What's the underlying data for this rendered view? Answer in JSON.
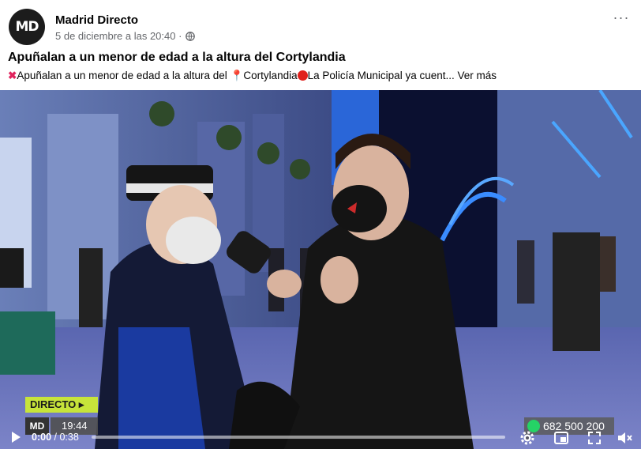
{
  "post": {
    "avatar_text": "MD",
    "page_name": "Madrid Directo",
    "date": "5 de diciembre a las 20:40 ·",
    "more_label": "···",
    "title": "Apuñalan a un menor de edad a la altura del Cortylandia",
    "body": {
      "part1": "Apuñalan a un menor de edad a la altura del ",
      "part2": "Cortylandia",
      "part3": "La Policía Municipal ya cuent...",
      "see_more": "Ver más"
    }
  },
  "video": {
    "live_label": "DIRECTO ▸",
    "channel_logo": "MD",
    "clock": "19:44",
    "whatsapp_number": "682 500 200",
    "current_time": "0:00",
    "duration": "/ 0:38",
    "progress": 0.0
  },
  "colors": {
    "accent": "#c7e43a",
    "text_secondary": "#65676b",
    "whatsapp": "#25d366"
  },
  "icons": [
    "globe-icon",
    "play-icon",
    "settings-icon",
    "picture-in-picture-icon",
    "fullscreen-icon",
    "volume-muted-icon",
    "whatsapp-icon"
  ]
}
